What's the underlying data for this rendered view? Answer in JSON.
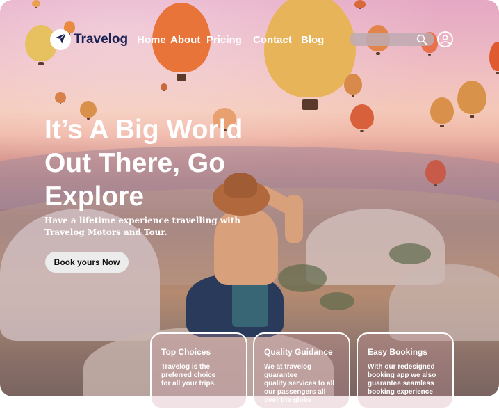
{
  "brand": {
    "name": "Travelog",
    "logo_icon": "paper-plane-icon",
    "color": "#1b2152"
  },
  "nav": {
    "links": [
      "Home",
      "About",
      "Pricing",
      "Contact",
      "Blog"
    ],
    "search_placeholder": "",
    "search_icon": "search-icon",
    "user_icon": "user-circle-icon"
  },
  "hero": {
    "title": "It’s A Big World Out There, Go Explore",
    "subtitle": "Have a lifetime experience travelling with Travelog Motors and Tour.",
    "cta_label": "Book yours  Now"
  },
  "features": [
    {
      "title": "Top Choices",
      "text": "Travelog is the\n preferred choice\nfor all your trips."
    },
    {
      "title": "Quality Guidance",
      "text": "We at travelog guarantee\nquality services to all\nour passengers all\nover the globe"
    },
    {
      "title": "Easy Bookings",
      "text": "With our redesigned\nbooking app we also\nguarantee seamless\nbooking experience"
    }
  ],
  "colors": {
    "text": "#ffffff",
    "card_border": "#ffffff",
    "cta_bg": "#ececec"
  }
}
